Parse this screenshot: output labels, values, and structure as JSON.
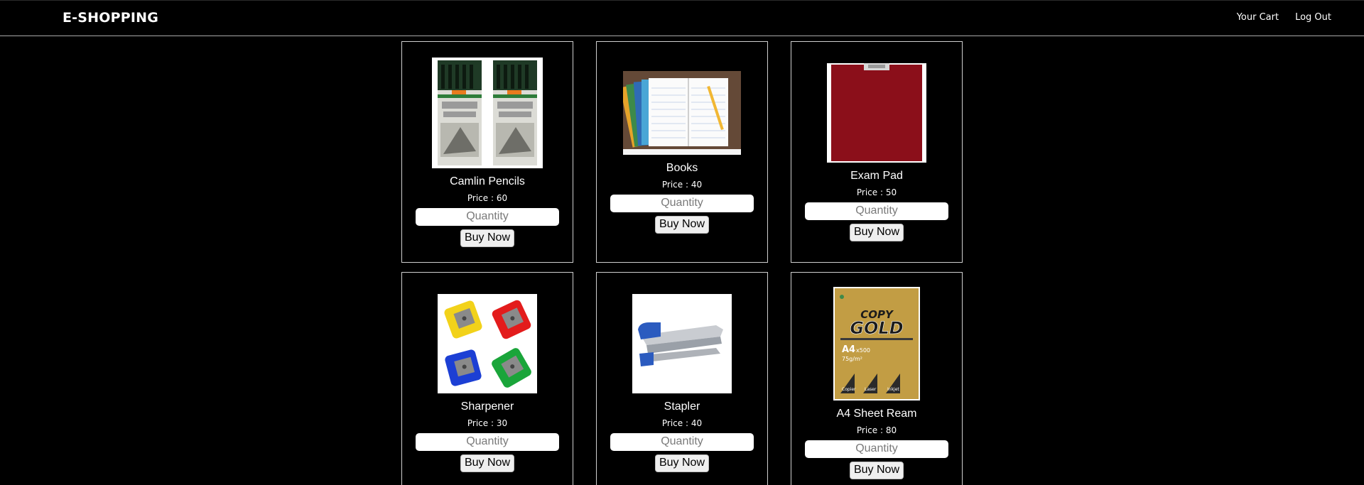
{
  "header": {
    "brand": "E-SHOPPING",
    "links": [
      "Your Cart",
      "Log Out"
    ]
  },
  "products": [
    {
      "name": "Camlin Pencils",
      "price_label": "Price : ",
      "price": "60",
      "image_icon": "pencil-box-image"
    },
    {
      "name": "Books",
      "price_label": "Price : ",
      "price": "40",
      "image_icon": "notebooks-image"
    },
    {
      "name": "Exam Pad",
      "price_label": "Price : ",
      "price": "50",
      "image_icon": "clipboard-image"
    },
    {
      "name": "Sharpener",
      "price_label": "Price : ",
      "price": "30",
      "image_icon": "sharpeners-image"
    },
    {
      "name": "Stapler",
      "price_label": "Price : ",
      "price": "40",
      "image_icon": "stapler-image"
    },
    {
      "name": "A4 Sheet Ream",
      "price_label": "Price : ",
      "price": "80",
      "image_icon": "paper-ream-image",
      "image_text": [
        "COPY",
        "GOLD",
        "A4",
        "x500",
        "75g/m²",
        "Copier",
        "Laser",
        "Inkjet"
      ]
    }
  ],
  "form": {
    "quantity_placeholder": "Quantity",
    "buy_label": "Buy Now"
  }
}
